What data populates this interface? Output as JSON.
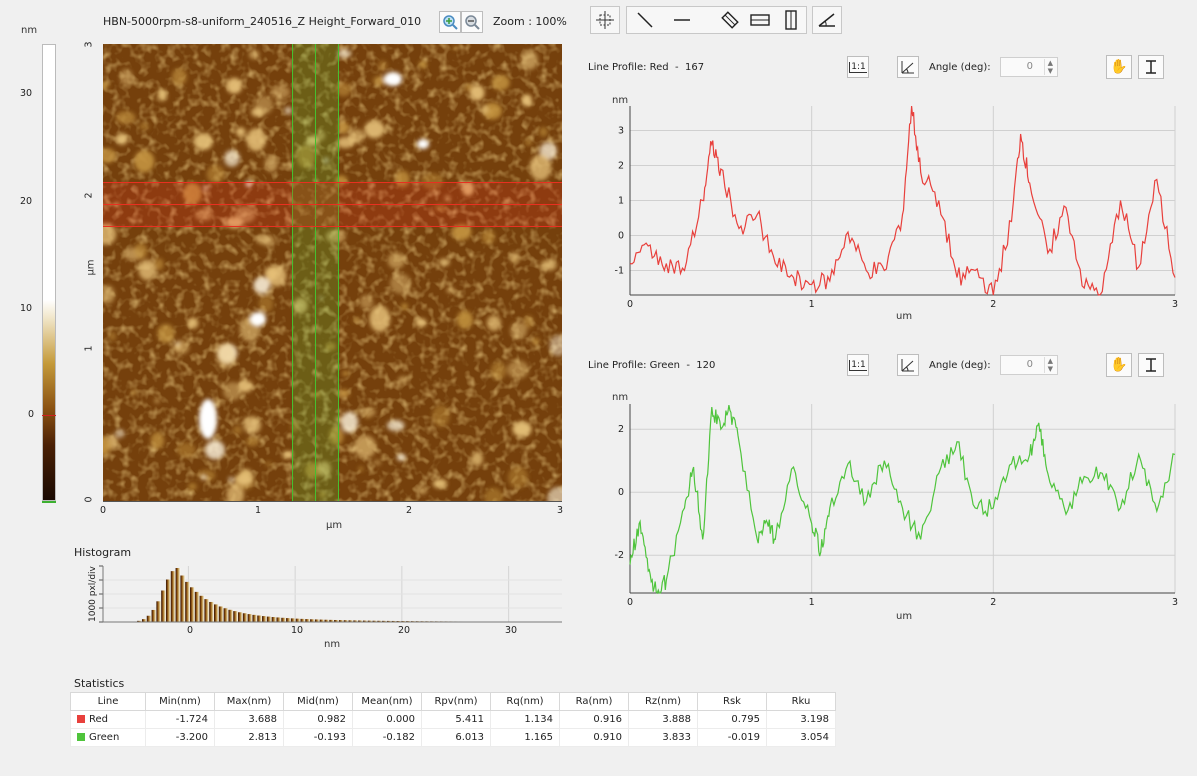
{
  "image": {
    "title": "HBN-5000rpm-s8-uniform_240516_Z Height_Forward_010",
    "zoom_label": "Zoom : 100%",
    "x_axis_label": "µm",
    "y_axis_label": "µm",
    "x_ticks": [
      "0",
      "1",
      "2",
      "3"
    ],
    "y_ticks": [
      "0",
      "1",
      "2",
      "3"
    ]
  },
  "colorbar": {
    "unit": "nm",
    "ticks": [
      "30",
      "20",
      "10",
      "0"
    ]
  },
  "histogram": {
    "title": "Histogram",
    "ylabel": "1000 pxl/div",
    "xlabel": "nm",
    "x_ticks": [
      "0",
      "10",
      "20",
      "30"
    ]
  },
  "toolbar": {
    "icons": [
      "select-region-icon",
      "line-diagonal-icon",
      "line-horizontal-icon",
      "line-vertical-icon",
      "box-diagonal-icon",
      "box-horizontal-icon",
      "box-vertical-icon",
      "angle-icon"
    ]
  },
  "profile_red": {
    "title": "Line Profile: Red",
    "index": "167",
    "angle_label": "Angle (deg):",
    "angle_value": "0",
    "ratio_label": "1:1",
    "ylabel": "nm",
    "xlabel": "um",
    "x_ticks": [
      "0",
      "1",
      "2",
      "3"
    ],
    "y_ticks": [
      "3",
      "2",
      "1",
      "0",
      "-1"
    ],
    "color": "#e8403c"
  },
  "profile_green": {
    "title": "Line Profile: Green",
    "index": "120",
    "angle_label": "Angle (deg):",
    "angle_value": "0",
    "ratio_label": "1:1",
    "ylabel": "nm",
    "xlabel": "um",
    "x_ticks": [
      "0",
      "1",
      "2",
      "3"
    ],
    "y_ticks": [
      "2",
      "0",
      "-2"
    ],
    "color": "#4fc43c"
  },
  "statistics": {
    "title": "Statistics",
    "headers": [
      "Line",
      "Min(nm)",
      "Max(nm)",
      "Mid(nm)",
      "Mean(nm)",
      "Rpv(nm)",
      "Rq(nm)",
      "Ra(nm)",
      "Rz(nm)",
      "Rsk",
      "Rku"
    ],
    "rows": [
      {
        "name": "Red",
        "swatch": "#e8403c",
        "values": [
          "-1.724",
          "3.688",
          "0.982",
          "0.000",
          "5.411",
          "1.134",
          "0.916",
          "3.888",
          "0.795",
          "3.198"
        ]
      },
      {
        "name": "Green",
        "swatch": "#4fc43c",
        "values": [
          "-3.200",
          "2.813",
          "-0.193",
          "-0.182",
          "6.013",
          "1.165",
          "0.910",
          "3.833",
          "-0.019",
          "3.054"
        ]
      }
    ]
  },
  "chart_data": [
    {
      "type": "line",
      "name": "Line Profile: Red",
      "xlabel": "um",
      "ylabel": "nm",
      "xlim": [
        0,
        3
      ],
      "ylim": [
        -1.7,
        3.7
      ],
      "x": [
        0,
        0.1,
        0.2,
        0.3,
        0.4,
        0.45,
        0.5,
        0.6,
        0.7,
        0.8,
        0.9,
        1.0,
        1.1,
        1.2,
        1.3,
        1.4,
        1.5,
        1.55,
        1.6,
        1.7,
        1.8,
        1.9,
        2.0,
        2.1,
        2.15,
        2.2,
        2.3,
        2.4,
        2.5,
        2.6,
        2.7,
        2.8,
        2.9,
        3.0
      ],
      "y": [
        -0.8,
        -0.3,
        -0.8,
        -1.0,
        1.0,
        2.6,
        1.9,
        0.2,
        0.6,
        -0.8,
        -1.2,
        -1.4,
        -1.3,
        0.1,
        -1.0,
        -1.0,
        0.6,
        3.7,
        1.8,
        1.0,
        -1.2,
        -1.0,
        -1.7,
        0.4,
        2.9,
        1.5,
        -0.5,
        0.8,
        -1.5,
        -1.6,
        1.0,
        -0.9,
        1.6,
        -1.2
      ],
      "series": [
        {
          "name": "Red",
          "color": "#e8403c"
        }
      ]
    },
    {
      "type": "line",
      "name": "Line Profile: Green",
      "xlabel": "um",
      "ylabel": "nm",
      "xlim": [
        0,
        3
      ],
      "ylim": [
        -3.2,
        2.8
      ],
      "x": [
        0,
        0.05,
        0.1,
        0.15,
        0.2,
        0.3,
        0.35,
        0.4,
        0.45,
        0.5,
        0.55,
        0.6,
        0.7,
        0.75,
        0.8,
        0.9,
        1.0,
        1.05,
        1.1,
        1.2,
        1.3,
        1.4,
        1.5,
        1.6,
        1.7,
        1.8,
        1.9,
        2.0,
        2.1,
        2.2,
        2.25,
        2.3,
        2.4,
        2.5,
        2.6,
        2.7,
        2.8,
        2.9,
        3.0
      ],
      "y": [
        -2.3,
        -1.0,
        -2.5,
        -3.2,
        -2.8,
        -0.5,
        0.8,
        -1.5,
        2.7,
        2.0,
        2.6,
        1.6,
        -1.5,
        -0.9,
        -1.5,
        0.8,
        -1.0,
        -1.9,
        -0.5,
        0.9,
        -0.3,
        1.0,
        -0.5,
        -1.5,
        0.6,
        1.6,
        -0.5,
        -0.5,
        0.9,
        1.2,
        2.2,
        0.6,
        -0.7,
        0.5,
        0.6,
        -0.5,
        1.2,
        -0.6,
        1.2
      ],
      "series": [
        {
          "name": "Green",
          "color": "#4fc43c"
        }
      ]
    },
    {
      "type": "bar",
      "name": "Histogram",
      "xlabel": "nm",
      "ylabel": "1000 pxl/div",
      "xlim": [
        -8,
        35
      ]
    }
  ]
}
